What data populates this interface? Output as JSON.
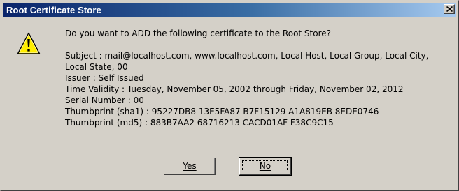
{
  "window": {
    "title": "Root Certificate Store",
    "close_icon": "close-icon"
  },
  "message": {
    "question": "Do you want to ADD the following certificate to the Root Store?",
    "details": [
      "Subject : mail@localhost.com, www.localhost.com, Local Host, Local Group, Local City,",
      "Local State, 00",
      "Issuer : Self Issued",
      "Time Validity : Tuesday, November 05, 2002 through Friday, November 02, 2012",
      "Serial Number : 00",
      "Thumbprint (sha1) : 95227DB8 13E5FA87 B7F15129 A1A819EB 8EDE0746",
      "Thumbprint (md5) : 883B7AA2 68716213 CACD01AF F38C9C15"
    ]
  },
  "buttons": {
    "yes_label": "Yes",
    "no_label": "No"
  },
  "colors": {
    "titlebar_start": "#0a246a",
    "titlebar_end": "#a6caf0",
    "face": "#d4d0c8",
    "warning_yellow": "#ffee00"
  },
  "icons": {
    "warning": "warning-icon"
  }
}
